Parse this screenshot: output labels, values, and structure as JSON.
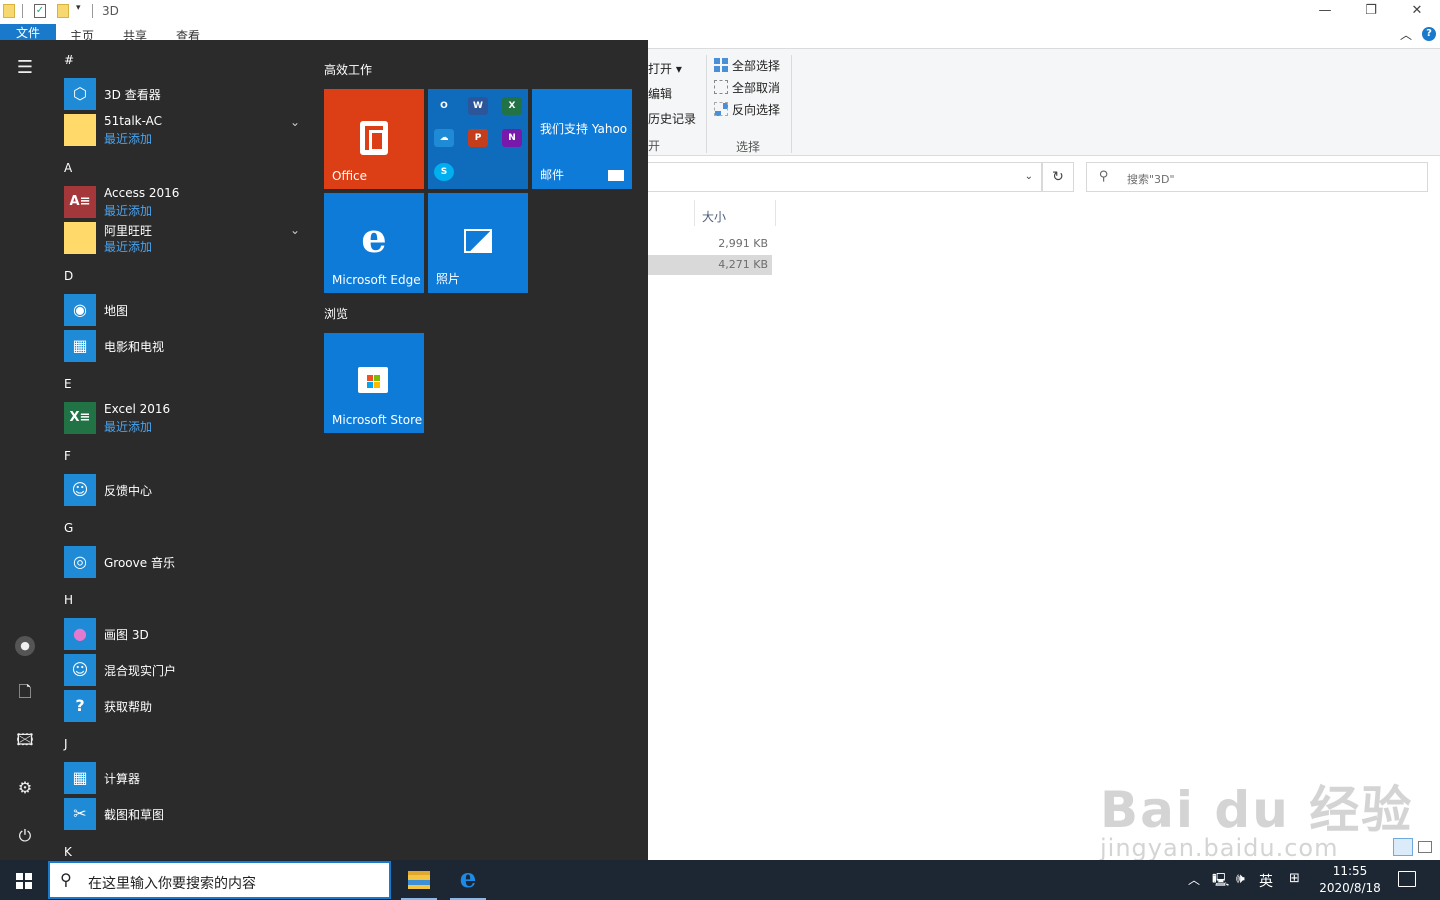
{
  "explorer": {
    "title": "3D",
    "tabs": [
      "文件",
      "主页",
      "共享",
      "查看"
    ],
    "ribbon": {
      "open": "打开 ▾",
      "edit": "编辑",
      "history": "历史记录",
      "open_group_frag": "开",
      "select_all": "全部选择",
      "select_none": "全部取消",
      "invert_selection": "反向选择",
      "select_group": "选择"
    },
    "search_placeholder": "搜索\"3D\"",
    "column_size": "大小",
    "sizes": [
      "2,991 KB",
      "4,271 KB"
    ]
  },
  "watermark": {
    "brand": "Bai du 经验",
    "url": "jingyan.baidu.com"
  },
  "start_menu": {
    "letters": [
      "#",
      "A",
      "D",
      "E",
      "F",
      "G",
      "H",
      "J",
      "K"
    ],
    "apps": [
      {
        "name": "3D 查看器",
        "icon": "cube-icon"
      },
      {
        "name": "51talk-AC",
        "sub": "最近添加",
        "icon": "folder-icon"
      },
      {
        "name": "Access 2016",
        "sub": "最近添加",
        "icon": "access-icon"
      },
      {
        "name": "阿里旺旺",
        "sub": "最近添加",
        "icon": "folder-icon"
      },
      {
        "name": "地图",
        "icon": "maps-icon"
      },
      {
        "name": "电影和电视",
        "icon": "film-icon"
      },
      {
        "name": "Excel 2016",
        "sub": "最近添加",
        "icon": "excel-icon"
      },
      {
        "name": "反馈中心",
        "icon": "feedback-icon"
      },
      {
        "name": "Groove 音乐",
        "icon": "groove-icon"
      },
      {
        "name": "画图 3D",
        "icon": "paint3d-icon"
      },
      {
        "name": "混合现实门户",
        "icon": "mixed-reality-icon"
      },
      {
        "name": "获取帮助",
        "icon": "help-icon"
      },
      {
        "name": "计算器",
        "icon": "calculator-icon"
      },
      {
        "name": "截图和草图",
        "icon": "snip-icon"
      }
    ],
    "groups": [
      "高效工作",
      "浏览"
    ],
    "tiles": {
      "office": "Office",
      "mail_text": "我们支持 Yahoo",
      "mail_label": "邮件",
      "edge": "Microsoft Edge",
      "photos": "照片",
      "store": "Microsoft Store"
    }
  },
  "taskbar": {
    "search_placeholder": "在这里输入你要搜索的内容",
    "lang": "英",
    "time": "11:55",
    "date": "2020/8/18"
  }
}
